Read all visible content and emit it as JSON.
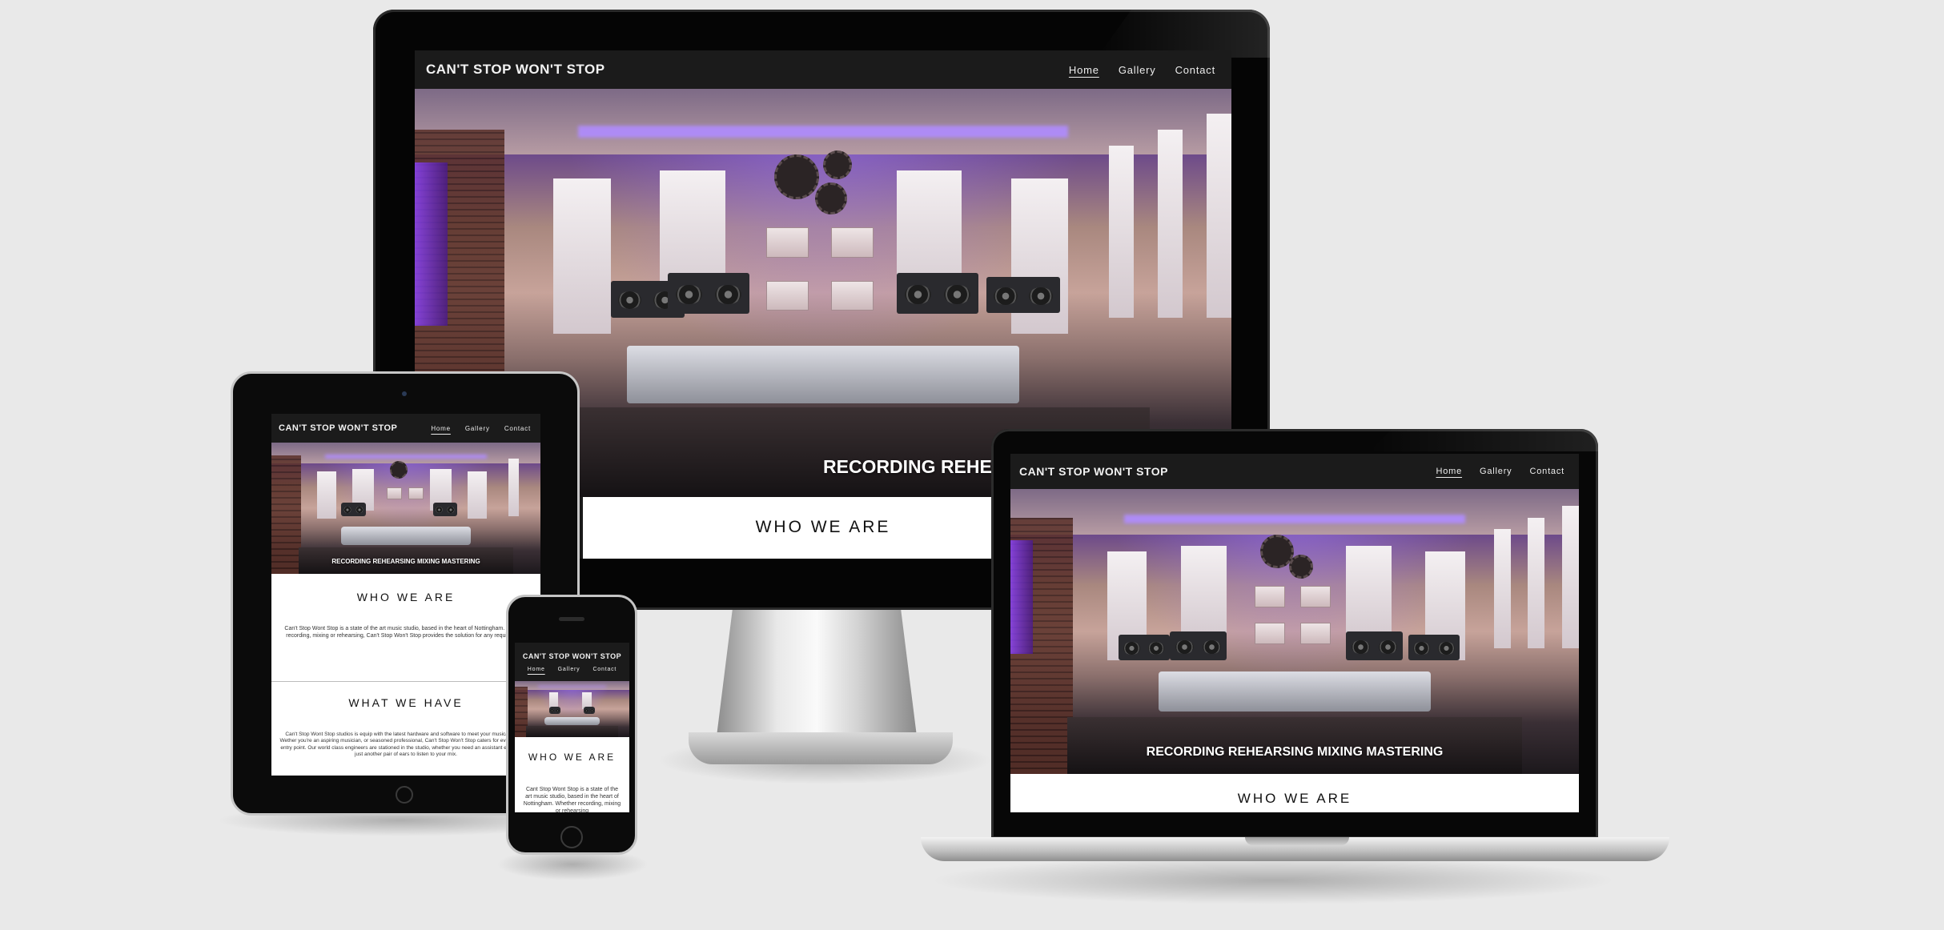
{
  "site": {
    "brand": "CAN'T STOP WON'T STOP",
    "nav": [
      {
        "label": "Home",
        "active": true
      },
      {
        "label": "Gallery",
        "active": false
      },
      {
        "label": "Contact",
        "active": false
      }
    ],
    "hero_tagline": "RECORDING REHEARSING MIXING MASTERING",
    "about_title": "WHO WE ARE",
    "about_text": "Can't Stop Wont Stop is a state of the art music studio, based in the heart of Nottingham. Whether recording, mixing or rehearsing, Can't Stop Won't Stop provides the solution for any requirement.",
    "about_text_phone": "Cant Stop Wont Stop is a state of the art music studio, based in the heart of Nottingham. Whether recording, mixing or rehearsing",
    "have_title": "WHAT WE HAVE",
    "have_text": "Can't Stop Wont Stop studios is equip with the latest hardware and software to meet your musical needs. Wether you're an aspiring musician, or seasoned professional, Can't Stop Won't Stop caters for every musical entry point. Our world class engineers are stationed in the studio, whether you need an assistant engineer, or just another pair of ears to listen to your mix."
  },
  "colors": {
    "page_bg": "#e9e9e9",
    "nav_bg": "#1b1b1b",
    "device_frame": "#0a0a0a",
    "silver": "#c9c9c9"
  }
}
